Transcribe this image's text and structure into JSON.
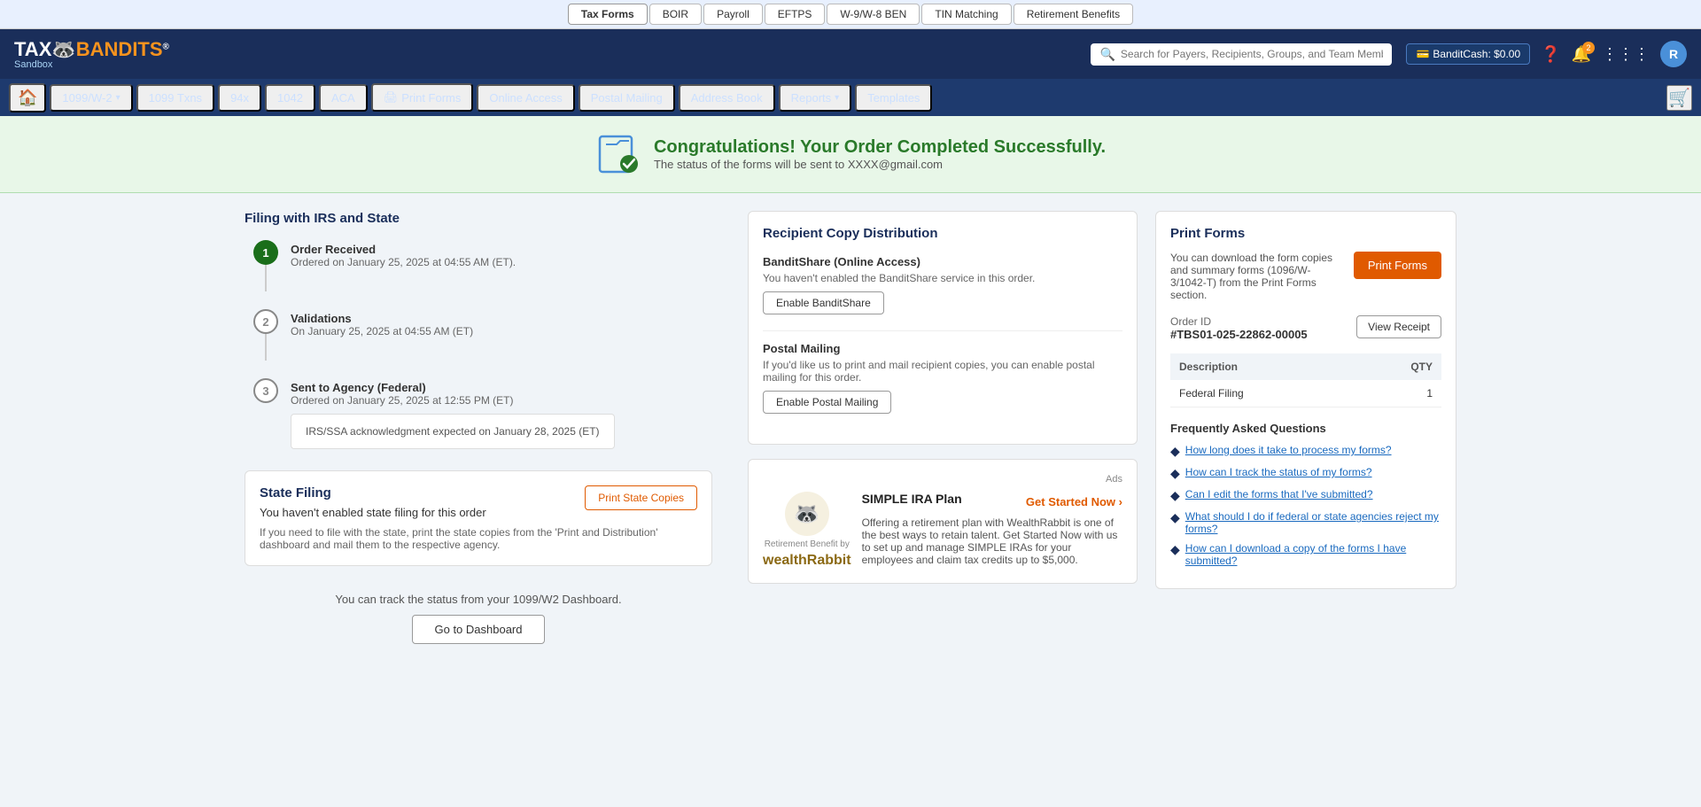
{
  "topTabs": [
    {
      "label": "Tax Forms",
      "active": true
    },
    {
      "label": "BOIR"
    },
    {
      "label": "Payroll"
    },
    {
      "label": "EFTPS"
    },
    {
      "label": "W-9/W-8 BEN"
    },
    {
      "label": "TIN Matching"
    },
    {
      "label": "Retirement Benefits"
    }
  ],
  "header": {
    "logoLine1": "TAX",
    "logoLine2": "BANDITS",
    "logoReg": "®",
    "sandbox": "Sandbox",
    "searchPlaceholder": "Search for Payers, Recipients, Groups, and Team Members",
    "banditCash": "BanditCash: $0.00",
    "notificationCount": "2",
    "avatarLetter": "R"
  },
  "nav": {
    "items": [
      {
        "label": "1099/W-2",
        "hasCaret": true
      },
      {
        "label": "1099 Txns"
      },
      {
        "label": "94x"
      },
      {
        "label": "1042"
      },
      {
        "label": "ACA"
      },
      {
        "label": "Print Forms",
        "hasIcon": true
      },
      {
        "label": "Online Access"
      },
      {
        "label": "Postal Mailing"
      },
      {
        "label": "Address Book"
      },
      {
        "label": "Reports",
        "hasCaret": true
      },
      {
        "label": "Templates"
      }
    ]
  },
  "successBanner": {
    "title": "Congratulations! Your Order Completed Successfully.",
    "subtitle": "The status of the forms will be sent to XXXX@gmail.com"
  },
  "filingSection": {
    "title": "Filing with IRS and State",
    "steps": [
      {
        "number": "1",
        "filled": true,
        "label": "Order Received",
        "detail": "Ordered on January 25, 2025 at 04:55 AM (ET)."
      },
      {
        "number": "2",
        "filled": false,
        "label": "Validations",
        "detail": "On January 25, 2025 at 04:55 AM (ET)"
      },
      {
        "number": "3",
        "filled": false,
        "label": "Sent to Agency (Federal)",
        "detail": "Ordered on January 25, 2025 at 12:55 PM (ET)",
        "box": "IRS/SSA acknowledgment expected on January 28, 2025 (ET)"
      }
    ]
  },
  "stateFiling": {
    "title": "State Filing",
    "description": "You haven't enabled state filing for this order",
    "note": "If you need to file with the state, print the state copies from the 'Print and Distribution' dashboard and mail them to the respective agency.",
    "printStateCopiesLabel": "Print State Copies"
  },
  "trackSection": {
    "text": "You can track the status from your 1099/W2 Dashboard.",
    "buttonLabel": "Go to Dashboard"
  },
  "recipientSection": {
    "title": "Recipient Copy Distribution",
    "banditShare": {
      "title": "BanditShare (Online Access)",
      "description": "You haven't enabled the BanditShare service in this order.",
      "buttonLabel": "Enable BanditShare"
    },
    "postalMailing": {
      "title": "Postal Mailing",
      "description": "If you'd like us to print and mail recipient copies, you can enable postal mailing for this order.",
      "buttonLabel": "Enable Postal Mailing"
    }
  },
  "printFormsSection": {
    "title": "Print Forms",
    "description": "You can download the form copies and summary forms (1096/W-3/1042-T) from the Print Forms section.",
    "printButtonLabel": "Print Forms",
    "orderId": {
      "label": "Order ID",
      "value": "#TBS01-025-22862-00005"
    },
    "viewReceiptLabel": "View Receipt",
    "tableHeaders": [
      "Description",
      "QTY"
    ],
    "tableRows": [
      {
        "description": "Federal Filing",
        "qty": "1"
      }
    ]
  },
  "faq": {
    "title": "Frequently Asked Questions",
    "items": [
      {
        "text": "How long does it take to process my forms?"
      },
      {
        "text": "How can I track the status of my forms?"
      },
      {
        "text": "Can I edit the forms that I've submitted?"
      },
      {
        "text": "What should I do if federal or state agencies reject my forms?"
      },
      {
        "text": "How can I download a copy of the forms I have submitted?"
      }
    ]
  },
  "ad": {
    "adsLabel": "Ads",
    "byLabel": "Retirement Benefit by",
    "logoText": "wealthRabbit",
    "title": "SIMPLE IRA Plan",
    "getStartedLabel": "Get Started Now",
    "description": "Offering a retirement plan with WealthRabbit is one of the best ways to retain talent. Get Started Now with us to set up and manage SIMPLE IRAs for your employees and claim tax credits up to $5,000."
  }
}
